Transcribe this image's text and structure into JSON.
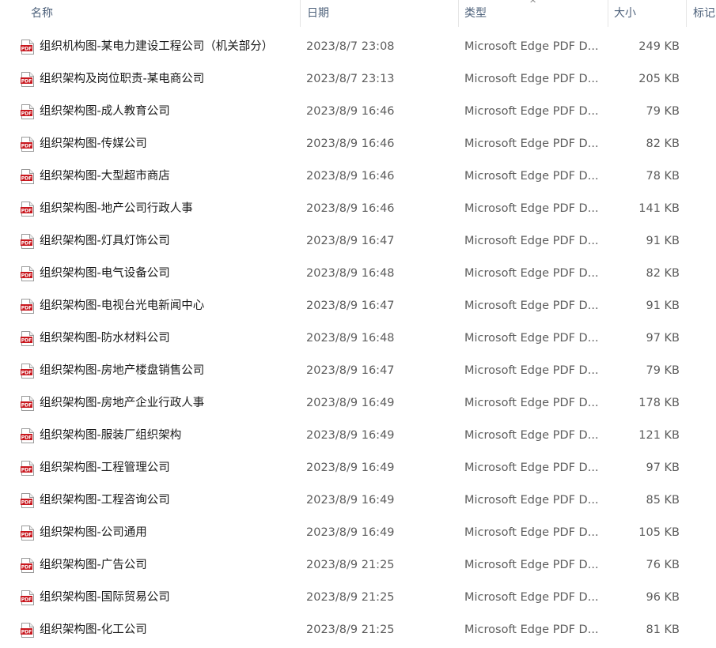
{
  "columns": {
    "name": "名称",
    "date": "日期",
    "type": "类型",
    "size": "大小",
    "tags": "标记"
  },
  "sort_indicator": "^",
  "file_icon": "pdf-file-icon",
  "files": [
    {
      "name": "组织机构图-某电力建设工程公司（机关部分）",
      "date": "2023/8/7 23:08",
      "type": "Microsoft Edge PDF D...",
      "size": "249 KB"
    },
    {
      "name": "组织架构及岗位职责-某电商公司",
      "date": "2023/8/7 23:13",
      "type": "Microsoft Edge PDF D...",
      "size": "205 KB"
    },
    {
      "name": "组织架构图-成人教育公司",
      "date": "2023/8/9 16:46",
      "type": "Microsoft Edge PDF D...",
      "size": "79 KB"
    },
    {
      "name": "组织架构图-传媒公司",
      "date": "2023/8/9 16:46",
      "type": "Microsoft Edge PDF D...",
      "size": "82 KB"
    },
    {
      "name": "组织架构图-大型超市商店",
      "date": "2023/8/9 16:46",
      "type": "Microsoft Edge PDF D...",
      "size": "78 KB"
    },
    {
      "name": "组织架构图-地产公司行政人事",
      "date": "2023/8/9 16:46",
      "type": "Microsoft Edge PDF D...",
      "size": "141 KB"
    },
    {
      "name": "组织架构图-灯具灯饰公司",
      "date": "2023/8/9 16:47",
      "type": "Microsoft Edge PDF D...",
      "size": "91 KB"
    },
    {
      "name": "组织架构图-电气设备公司",
      "date": "2023/8/9 16:48",
      "type": "Microsoft Edge PDF D...",
      "size": "82 KB"
    },
    {
      "name": "组织架构图-电视台光电新闻中心",
      "date": "2023/8/9 16:47",
      "type": "Microsoft Edge PDF D...",
      "size": "91 KB"
    },
    {
      "name": "组织架构图-防水材料公司",
      "date": "2023/8/9 16:48",
      "type": "Microsoft Edge PDF D...",
      "size": "97 KB"
    },
    {
      "name": "组织架构图-房地产楼盘销售公司",
      "date": "2023/8/9 16:47",
      "type": "Microsoft Edge PDF D...",
      "size": "79 KB"
    },
    {
      "name": "组织架构图-房地产企业行政人事",
      "date": "2023/8/9 16:49",
      "type": "Microsoft Edge PDF D...",
      "size": "178 KB"
    },
    {
      "name": "组织架构图-服装厂组织架构",
      "date": "2023/8/9 16:49",
      "type": "Microsoft Edge PDF D...",
      "size": "121 KB"
    },
    {
      "name": "组织架构图-工程管理公司",
      "date": "2023/8/9 16:49",
      "type": "Microsoft Edge PDF D...",
      "size": "97 KB"
    },
    {
      "name": "组织架构图-工程咨询公司",
      "date": "2023/8/9 16:49",
      "type": "Microsoft Edge PDF D...",
      "size": "85 KB"
    },
    {
      "name": "组织架构图-公司通用",
      "date": "2023/8/9 16:49",
      "type": "Microsoft Edge PDF D...",
      "size": "105 KB"
    },
    {
      "name": "组织架构图-广告公司",
      "date": "2023/8/9 21:25",
      "type": "Microsoft Edge PDF D...",
      "size": "76 KB"
    },
    {
      "name": "组织架构图-国际贸易公司",
      "date": "2023/8/9 21:25",
      "type": "Microsoft Edge PDF D...",
      "size": "96 KB"
    },
    {
      "name": "组织架构图-化工公司",
      "date": "2023/8/9 21:25",
      "type": "Microsoft Edge PDF D...",
      "size": "81 KB"
    }
  ]
}
